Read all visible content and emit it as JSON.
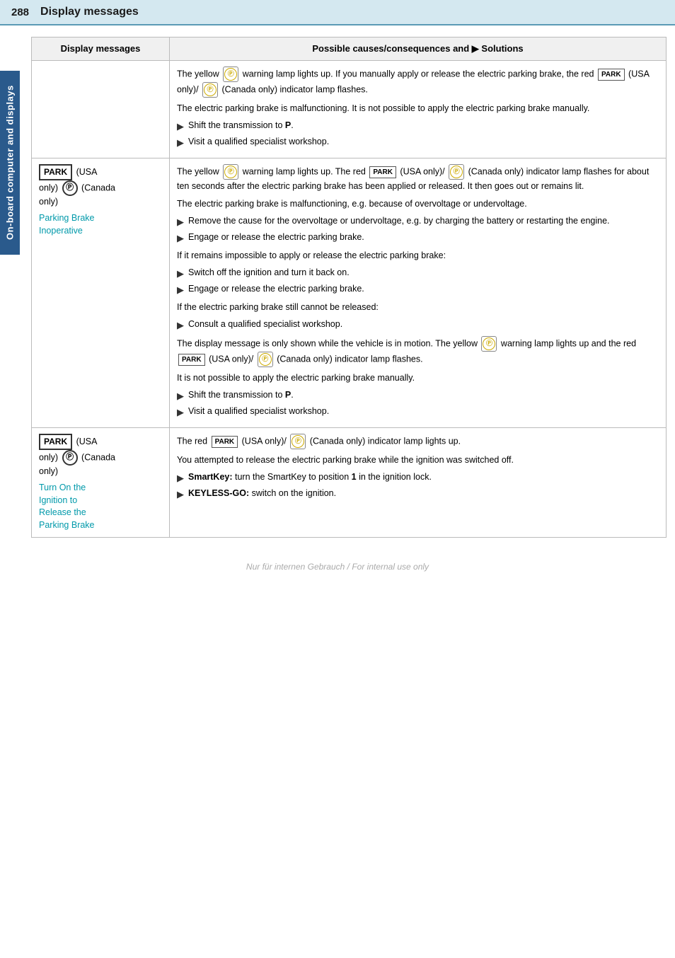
{
  "header": {
    "page_num": "288",
    "title": "Display messages"
  },
  "sidebar": {
    "label": "On-board computer and displays"
  },
  "table": {
    "col1_header": "Display messages",
    "col2_header": "Possible causes/consequences and ▶ Solutions"
  },
  "rows": [
    {
      "id": "row1",
      "display_msg_parts": [],
      "display_msg_empty": true,
      "solutions": [
        {
          "type": "para",
          "text": "The yellow warning lamp lights up. If you manually apply or release the electric parking brake, the red PARK (USA only)/ P-circle (Canada only) indicator lamp flashes."
        },
        {
          "type": "para",
          "text": "The electric parking brake is malfunctioning. It is not possible to apply the electric parking brake manually."
        },
        {
          "type": "arrow",
          "text": "Shift the transmission to P."
        },
        {
          "type": "arrow",
          "text": "Visit a qualified specialist workshop."
        }
      ]
    },
    {
      "id": "row2",
      "display_msg_label": "PARK (USA only) / (P) (Canada only)",
      "display_msg_sublabel": "Parking Brake Inoperative",
      "solutions": [
        {
          "type": "para",
          "text": "The yellow warning lamp lights up. The red PARK (USA only)/ P-circle (Canada only) indicator lamp flashes for about ten seconds after the electric parking brake has been applied or released. It then goes out or remains lit."
        },
        {
          "type": "para",
          "text": "The electric parking brake is malfunctioning, e.g. because of overvoltage or undervoltage."
        },
        {
          "type": "arrow",
          "text": "Remove the cause for the overvoltage or undervoltage, e.g. by charging the battery or restarting the engine."
        },
        {
          "type": "arrow",
          "text": "Engage or release the electric parking brake."
        },
        {
          "type": "para",
          "text": "If it remains impossible to apply or release the electric parking brake:"
        },
        {
          "type": "arrow",
          "text": "Switch off the ignition and turn it back on."
        },
        {
          "type": "arrow",
          "text": "Engage or release the electric parking brake."
        },
        {
          "type": "para",
          "text": "If the electric parking brake still cannot be released:"
        },
        {
          "type": "arrow",
          "text": "Consult a qualified specialist workshop."
        },
        {
          "type": "para",
          "text": "The display message is only shown while the vehicle is in motion. The yellow warning lamp lights up and the red PARK (USA only)/ P-circle (Canada only) indicator lamp flashes."
        },
        {
          "type": "para",
          "text": "It is not possible to apply the electric parking brake manually."
        },
        {
          "type": "arrow",
          "text": "Shift the transmission to P."
        },
        {
          "type": "arrow",
          "text": "Visit a qualified specialist workshop."
        }
      ]
    },
    {
      "id": "row3",
      "display_msg_label": "PARK (USA only) / (P) (Canada only)",
      "display_msg_sublabel": "Turn On the Ignition to Release the Parking Brake",
      "solutions": [
        {
          "type": "para",
          "text": "The red PARK (USA only)/ P-circle (Canada only) indicator lamp lights up."
        },
        {
          "type": "para",
          "text": "You attempted to release the electric parking brake while the ignition was switched off."
        },
        {
          "type": "arrow_bold",
          "prefix": "SmartKey:",
          "text": " turn the SmartKey to position 1 in the ignition lock."
        },
        {
          "type": "arrow_bold",
          "prefix": "KEYLESS-GO:",
          "text": " switch on the ignition."
        }
      ]
    }
  ],
  "footer": {
    "text": "Nur für internen Gebrauch / For internal use only"
  }
}
